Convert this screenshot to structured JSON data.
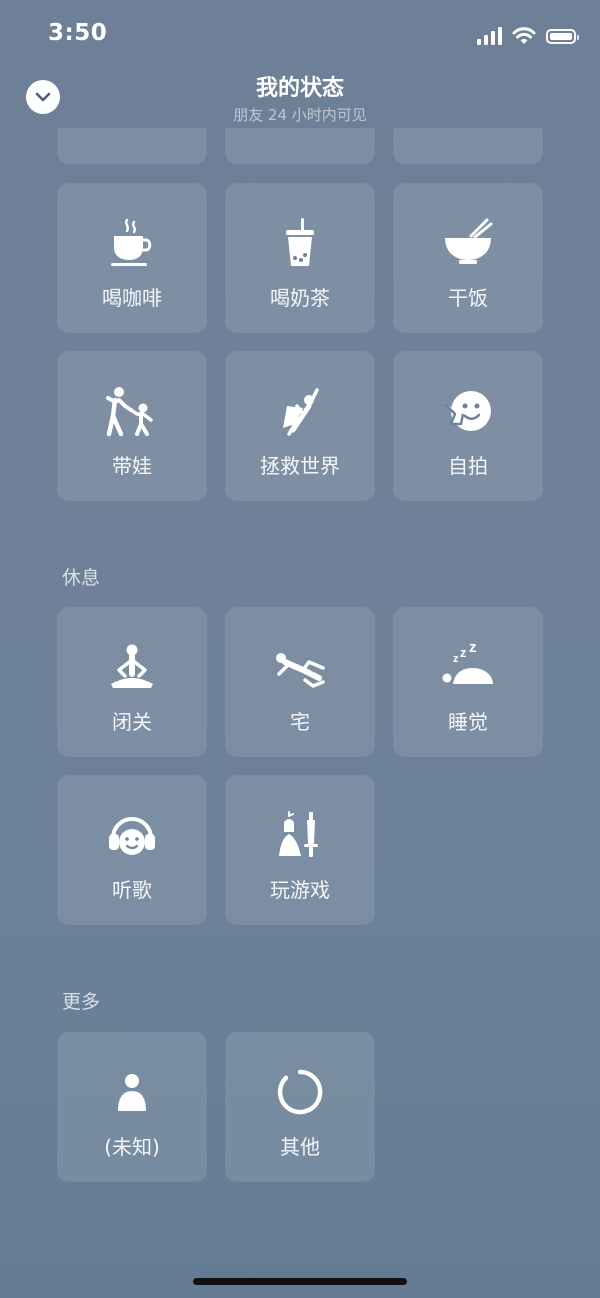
{
  "status_bar": {
    "time": "3:50"
  },
  "header": {
    "title": "我的状态",
    "subtitle": "朋友 24 小时内可见"
  },
  "sections": {
    "rest": {
      "title": "休息"
    },
    "more": {
      "title": "更多"
    }
  },
  "tiles": {
    "coffee": {
      "label": "喝咖啡",
      "icon": "coffee-cup-icon"
    },
    "milk_tea": {
      "label": "喝奶茶",
      "icon": "bubble-tea-icon"
    },
    "eat": {
      "label": "干饭",
      "icon": "rice-bowl-icon"
    },
    "childcare": {
      "label": "带娃",
      "icon": "parent-child-icon"
    },
    "save_world": {
      "label": "拯救世界",
      "icon": "flying-hero-icon"
    },
    "selfie": {
      "label": "自拍",
      "icon": "selfie-face-icon"
    },
    "meditate": {
      "label": "闭关",
      "icon": "meditation-icon"
    },
    "stay_home": {
      "label": "宅",
      "icon": "lying-down-icon"
    },
    "sleep": {
      "label": "睡觉",
      "icon": "sleeping-icon"
    },
    "music": {
      "label": "听歌",
      "icon": "headphones-icon"
    },
    "gaming": {
      "label": "玩游戏",
      "icon": "game-character-icon"
    },
    "unknown": {
      "label": "(未知)",
      "icon": "person-icon"
    },
    "other": {
      "label": "其他",
      "icon": "circle-icon"
    }
  },
  "colors": {
    "background_top": "#6e7f98",
    "background_bottom": "#647c93",
    "tile": "rgba(255,255,255,0.11)",
    "text": "#ffffff"
  }
}
